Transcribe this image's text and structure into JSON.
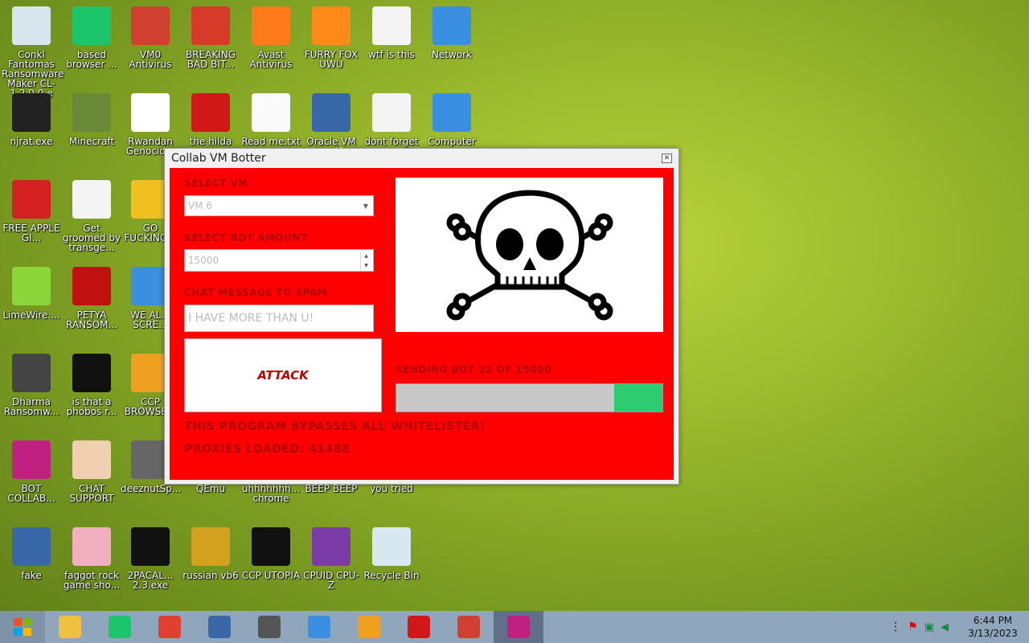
{
  "desktop_icons": [
    {
      "label": "Conkl Fantomas Ransomware Maker CL-1.2.0.0.e",
      "icon": "window-app-icon",
      "color": "#d8e4ee"
    },
    {
      "label": "based browser ...",
      "icon": "chat-icon",
      "color": "#1cc46a"
    },
    {
      "label": "VM0 Antivirus",
      "icon": "shield-icon",
      "color": "#d04030"
    },
    {
      "label": "BREAKING BAD BIT...",
      "icon": "angry-bird-icon",
      "color": "#d83a2a"
    },
    {
      "label": "Avast Antivirus",
      "icon": "avast-icon",
      "color": "#ff7a1a"
    },
    {
      "label": "FURRY FOX UWU",
      "icon": "firefox-icon",
      "color": "#ff8a1a"
    },
    {
      "label": "wtf is this",
      "icon": "document-icon",
      "color": "#f4f4f4"
    },
    {
      "label": "Network",
      "icon": "network-icon",
      "color": "#3a8fe0"
    },
    {
      "label": "njrat.exe",
      "icon": "skull-icon",
      "color": "#222222"
    },
    {
      "label": "Minecraft",
      "icon": "grass-block-icon",
      "color": "#6a8a3a"
    },
    {
      "label": "Rwandan Genocid...",
      "icon": "meme-face-icon",
      "color": "#ffffff"
    },
    {
      "label": "the hilda ide",
      "icon": "devcpp-icon",
      "color": "#d01818"
    },
    {
      "label": "Read me.txt",
      "icon": "text-file-icon",
      "color": "#fafafa"
    },
    {
      "label": "Oracle VM VirtualBox",
      "icon": "virtualbox-icon",
      "color": "#3868a8"
    },
    {
      "label": "dont forget to...",
      "icon": "document-icon",
      "color": "#f4f4f4"
    },
    {
      "label": "Computer",
      "icon": "computer-icon",
      "color": "#3a8fe0"
    },
    {
      "label": "FREE APPLE GI...",
      "icon": "apple-icon",
      "color": "#d42020"
    },
    {
      "label": "Get groomed by transge...",
      "icon": "document-icon",
      "color": "#f4f4f4"
    },
    {
      "label": "GO FUCKING...",
      "icon": "die-icon",
      "color": "#f0c020"
    },
    {
      "label": "LimeWire....",
      "icon": "lime-icon",
      "color": "#8bd43a"
    },
    {
      "label": "PETYA RANSOM...",
      "icon": "petya-icon",
      "color": "#c01010"
    },
    {
      "label": "WE AL... SCRE...",
      "icon": "computer-icon",
      "color": "#3a8fe0"
    },
    {
      "label": "Dharma Ransomw...",
      "icon": "skull-icon",
      "color": "#444444"
    },
    {
      "label": "is that a phobos r...",
      "icon": "icq-icon",
      "color": "#111111"
    },
    {
      "label": "CCP BROWSE...",
      "icon": "chrome-icon",
      "color": "#f0a020"
    },
    {
      "label": "BOT COLLAB...",
      "icon": "monitor-icon",
      "color": "#c02080"
    },
    {
      "label": "CHAT SUPPORT",
      "icon": "doctor-icon",
      "color": "#f0d0b0"
    },
    {
      "label": "deeznutSp...",
      "icon": "windows-stack-icon",
      "color": "#666666"
    },
    {
      "label": "QEmu",
      "icon": "app-icon",
      "color": "#888888"
    },
    {
      "label": "uhhhhhhh... chrome",
      "icon": "app-icon",
      "color": "#888888"
    },
    {
      "label": "BEEP BEEP",
      "icon": "app-icon",
      "color": "#888888"
    },
    {
      "label": "you tried",
      "icon": "app-icon",
      "color": "#888888"
    },
    {
      "label": "fake",
      "icon": "virtualbox-icon",
      "color": "#3868a8"
    },
    {
      "label": "faggot rock game sho...",
      "icon": "pig-icon",
      "color": "#f0b0c0"
    },
    {
      "label": "2PACAL... 2.3.exe",
      "icon": "cmd-icon",
      "color": "#111111"
    },
    {
      "label": "russian vb6",
      "icon": "vb6-icon",
      "color": "#d4a020"
    },
    {
      "label": "CCP UTOPIA",
      "icon": "utopia-icon",
      "color": "#111111"
    },
    {
      "label": "CPUID CPU-Z",
      "icon": "cpuz-icon",
      "color": "#7a3aa8"
    },
    {
      "label": "Recycle Bin",
      "icon": "recycle-bin-icon",
      "color": "#d8e8f0"
    }
  ],
  "dialog": {
    "title": "Collab VM Botter",
    "select_vm_label": "SELECT VM",
    "select_vm_value": "VM 6",
    "bot_amount_label": "SELECT BOT AMOUNT",
    "bot_amount_value": "15000",
    "chat_label": "CHAT MESSAGE TO SPAM",
    "chat_value": "I HAVE MORE THAN U!",
    "attack_label": "ATTACK",
    "status_text": "SENDING BOT 22 OF 15000",
    "progress_fraction": 0.18,
    "whitelist_text": "THIS PROGRAM BYPASSES ALL WHITELISTER!",
    "proxies_text": "PROXIES LOADED: 41488"
  },
  "taskbar": {
    "apps": [
      {
        "name": "file-explorer",
        "color": "#f0c040"
      },
      {
        "name": "chat",
        "color": "#1cc46a"
      },
      {
        "name": "chrome",
        "color": "#e04030"
      },
      {
        "name": "virtualbox",
        "color": "#3868a8"
      },
      {
        "name": "windows-stack",
        "color": "#555555"
      },
      {
        "name": "computer",
        "color": "#3a8fe0"
      },
      {
        "name": "browser",
        "color": "#f0a020"
      },
      {
        "name": "devcpp",
        "color": "#d01818"
      },
      {
        "name": "shield",
        "color": "#d04030"
      },
      {
        "name": "bot-collab",
        "color": "#c02080"
      }
    ],
    "time": "6:44 PM",
    "date": "3/13/2023"
  }
}
